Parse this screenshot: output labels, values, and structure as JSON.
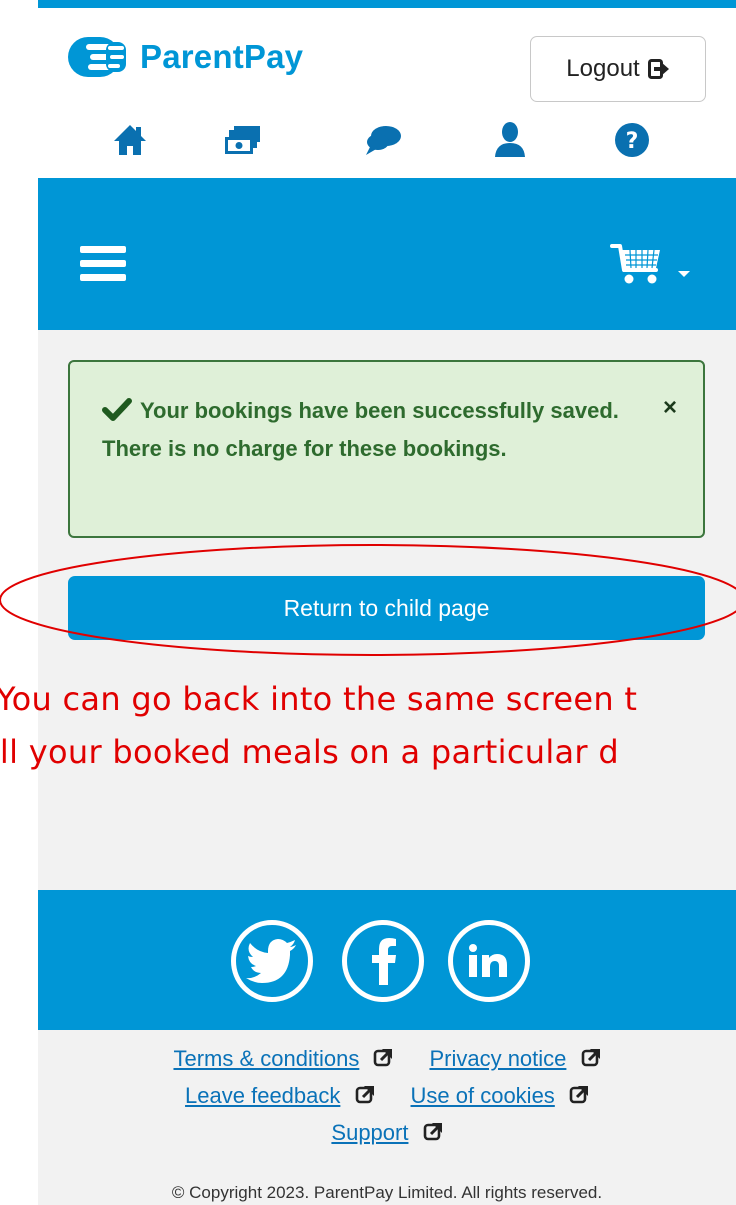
{
  "header": {
    "brand": "ParentPay",
    "logout_label": "Logout",
    "nav_icons": [
      "home-icon",
      "payments-icon",
      "messages-icon",
      "profile-icon",
      "help-icon"
    ]
  },
  "alert": {
    "message": "Your bookings have been successfully saved. There is no charge for these bookings.",
    "close": "×"
  },
  "actions": {
    "return_label": "Return to child page"
  },
  "annotation": {
    "line1": "You can go back into the same screen t",
    "line2": "all your booked meals on a particular d"
  },
  "footer": {
    "social": [
      "twitter-icon",
      "facebook-icon",
      "linkedin-icon"
    ],
    "links": {
      "terms": "Terms & conditions",
      "privacy": "Privacy notice",
      "feedback": "Leave feedback",
      "cookies": "Use of cookies",
      "support": "Support"
    },
    "copyright": "© Copyright 2023. ParentPay Limited. All rights reserved."
  },
  "colors": {
    "brand_blue": "#0096d6",
    "success_bg": "#dff0d8",
    "success_border": "#3c763d",
    "annotation_red": "#e00000"
  }
}
